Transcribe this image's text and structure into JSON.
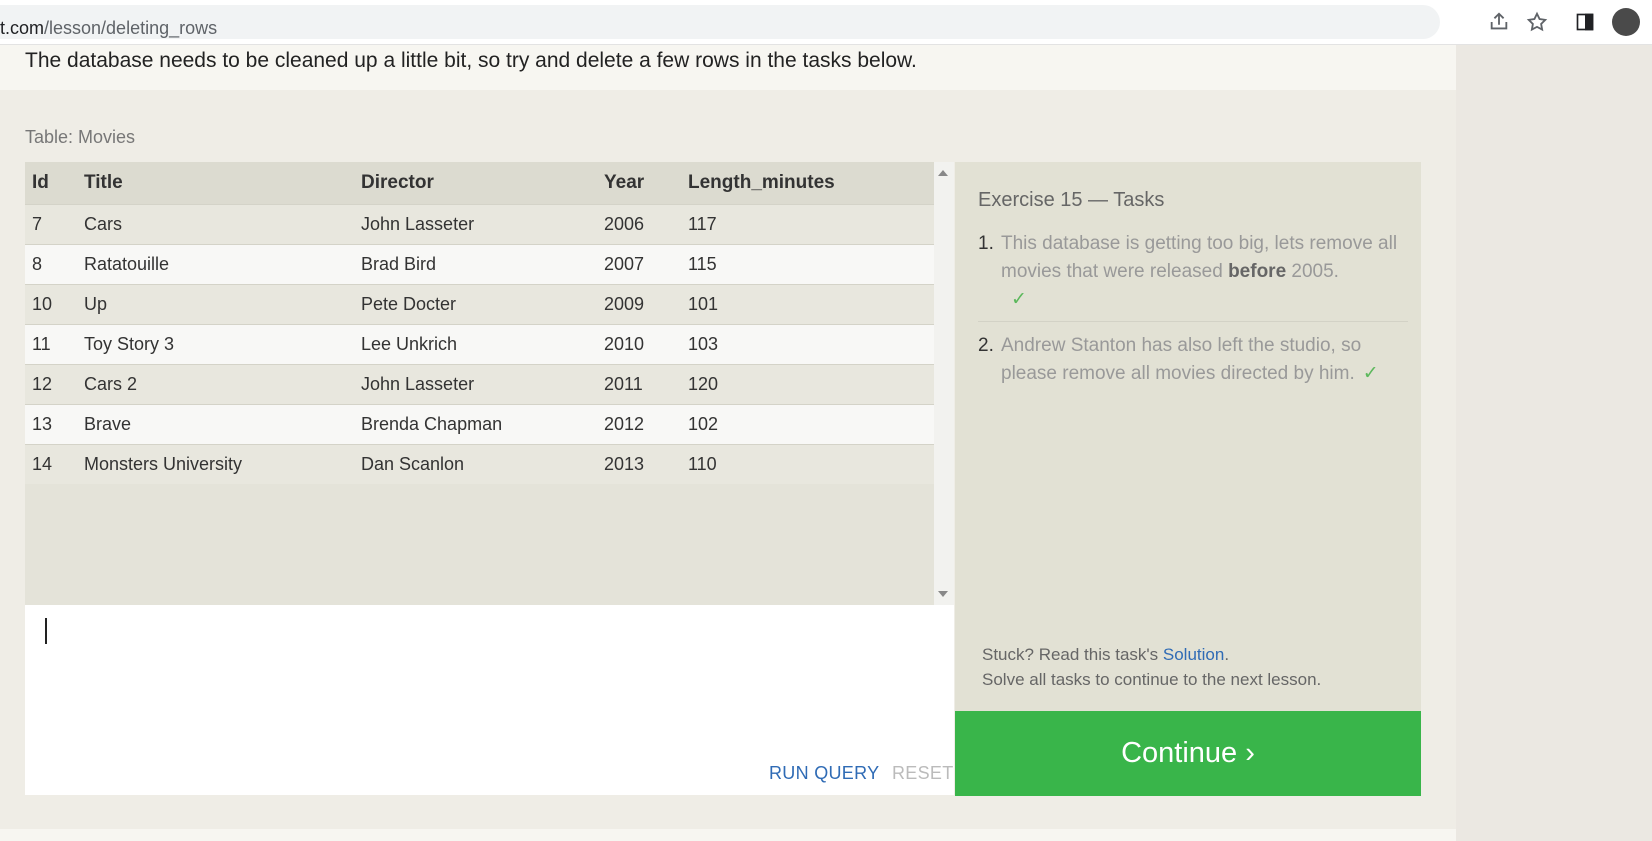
{
  "browser": {
    "url_host_tail": "t.com",
    "url_path": "/lesson/deleting_rows"
  },
  "lesson": {
    "lead_text": "The database needs to be cleaned up a little bit, so try and delete a few rows in the tasks below."
  },
  "table": {
    "caption": "Table: Movies",
    "columns": [
      "Id",
      "Title",
      "Director",
      "Year",
      "Length_minutes"
    ],
    "rows": [
      [
        "7",
        "Cars",
        "John Lasseter",
        "2006",
        "117"
      ],
      [
        "8",
        "Ratatouille",
        "Brad Bird",
        "2007",
        "115"
      ],
      [
        "10",
        "Up",
        "Pete Docter",
        "2009",
        "101"
      ],
      [
        "11",
        "Toy Story 3",
        "Lee Unkrich",
        "2010",
        "103"
      ],
      [
        "12",
        "Cars 2",
        "John Lasseter",
        "2011",
        "120"
      ],
      [
        "13",
        "Brave",
        "Brenda Chapman",
        "2012",
        "102"
      ],
      [
        "14",
        "Monsters University",
        "Dan Scanlon",
        "2013",
        "110"
      ]
    ]
  },
  "editor": {
    "value": "",
    "run_label": "RUN QUERY",
    "reset_label": "RESET"
  },
  "tasks": {
    "title": "Exercise 15 — Tasks",
    "items": [
      {
        "num": "1.",
        "text_before": "This database is getting too big, lets remove all movies that were released ",
        "bold": "before",
        "text_after": " 2005.",
        "check": "✓"
      },
      {
        "num": "2.",
        "text": "Andrew Stanton has also left the studio, so please remove all movies directed by him.",
        "check": "✓"
      }
    ],
    "stuck_prefix": "Stuck? Read this task's ",
    "solution_label": "Solution",
    "stuck_suffix": ".",
    "solve_all": "Solve all tasks to continue to the next lesson."
  },
  "continue": {
    "label": "Continue ›"
  },
  "colors": {
    "continue_green": "#39b54a",
    "link_blue": "#2f6bb5",
    "check_green": "#5cb85c"
  },
  "icons": [
    "share-icon",
    "star-icon",
    "side-panel-icon",
    "profile-avatar"
  ]
}
